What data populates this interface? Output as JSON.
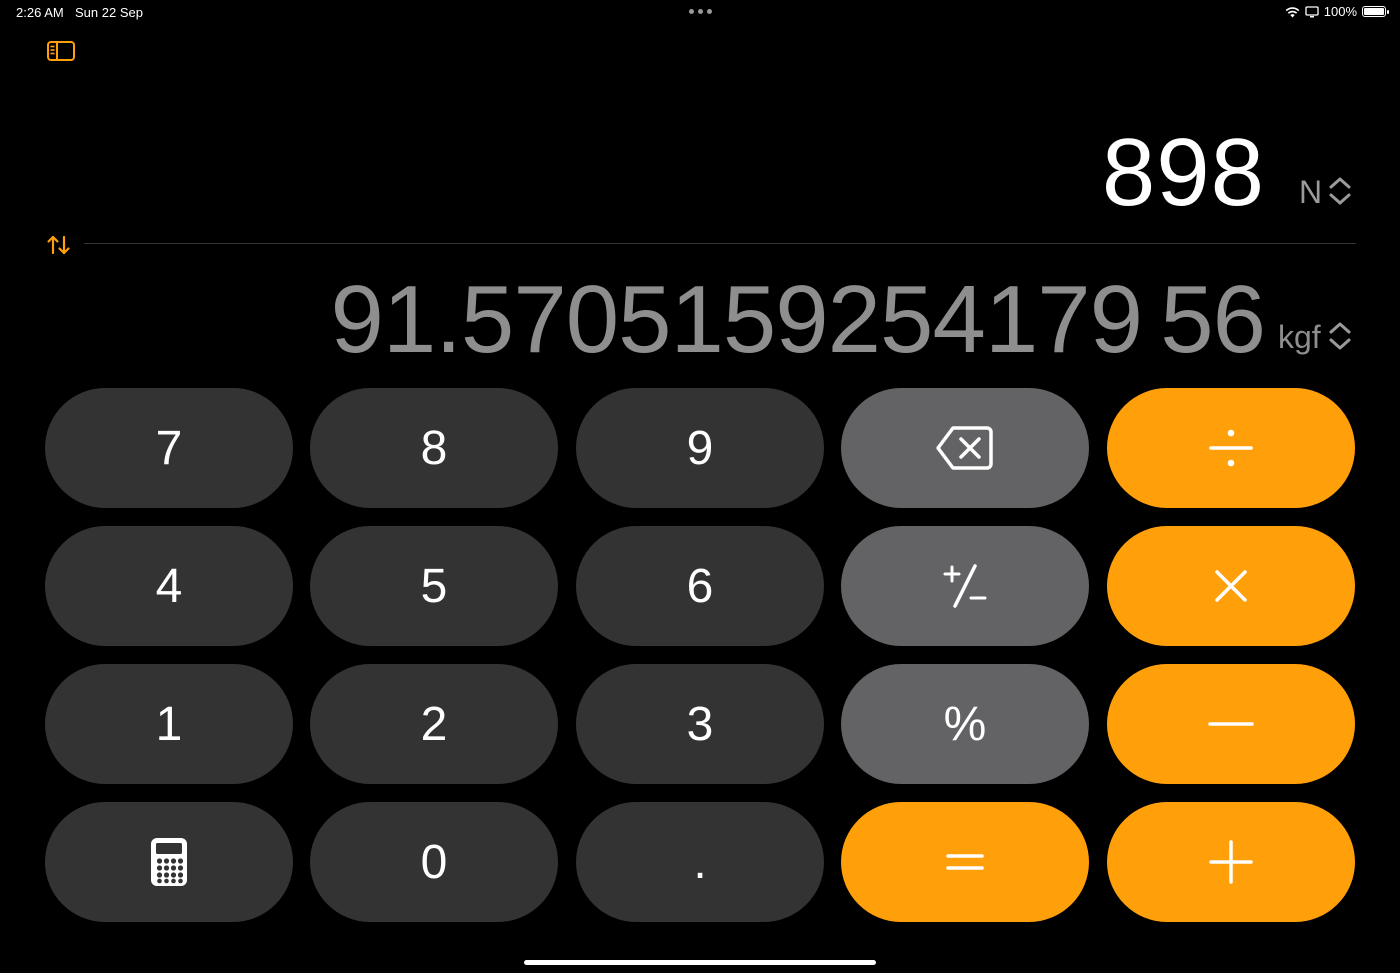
{
  "status_bar": {
    "time": "2:26 AM",
    "date": "Sun 22 Sep",
    "battery": "100%"
  },
  "display": {
    "primary_value": "898",
    "primary_unit": "N",
    "secondary_value": "91.5705159254179 56",
    "secondary_unit": "kgf"
  },
  "keypad": {
    "rows": [
      [
        "7",
        "8",
        "9",
        "backspace-icon",
        "÷"
      ],
      [
        "4",
        "5",
        "6",
        "+/-",
        "×"
      ],
      [
        "1",
        "2",
        "3",
        "%",
        "−"
      ],
      [
        "calculator-icon",
        "0",
        ".",
        "=",
        "+"
      ]
    ],
    "labels": {
      "seven": "7",
      "eight": "8",
      "nine": "9",
      "four": "4",
      "five": "5",
      "six": "6",
      "one": "1",
      "two": "2",
      "three": "3",
      "zero": "0",
      "decimal": ".",
      "percent": "%"
    }
  },
  "colors": {
    "accent": "#ff9f0a",
    "digit_key": "#333333",
    "function_key": "#636366",
    "secondary_text": "#8e8e8e"
  }
}
